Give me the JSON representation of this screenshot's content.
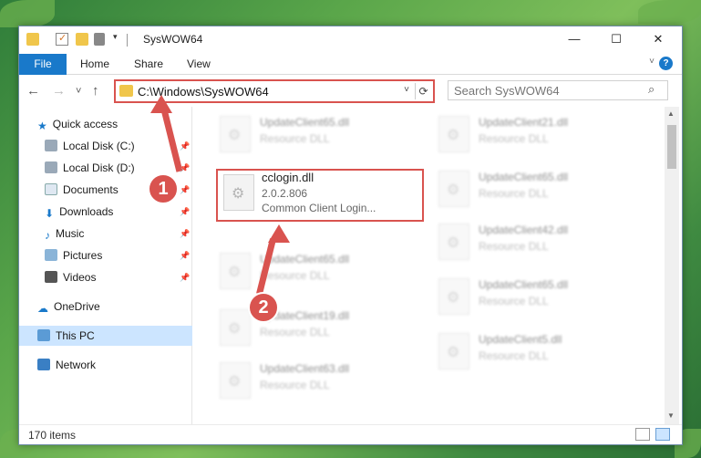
{
  "window": {
    "title": "SysWOW64",
    "minimize": "—",
    "maximize": "☐",
    "close": "✕"
  },
  "ribbon": {
    "tabs": [
      "File",
      "Home",
      "Share",
      "View"
    ],
    "help": "?"
  },
  "nav": {
    "back": "←",
    "forward": "→",
    "recent": "˅",
    "up": "↑",
    "address": "C:\\Windows\\SysWOW64",
    "search_placeholder": "Search SysWOW64"
  },
  "sidebar": {
    "items": [
      {
        "label": "Quick access",
        "pinned": false
      },
      {
        "label": "Local Disk (C:)",
        "pinned": true
      },
      {
        "label": "Local Disk (D:)",
        "pinned": true
      },
      {
        "label": "Documents",
        "pinned": true
      },
      {
        "label": "Downloads",
        "pinned": true
      },
      {
        "label": "Music",
        "pinned": true
      },
      {
        "label": "Pictures",
        "pinned": true
      },
      {
        "label": "Videos",
        "pinned": true
      },
      {
        "label": "OneDrive",
        "pinned": false
      },
      {
        "label": "This PC",
        "pinned": false
      },
      {
        "label": "Network",
        "pinned": false
      }
    ],
    "pin_glyph": "📌"
  },
  "files": {
    "left": [
      {
        "name": "UpdateClient65.dll",
        "type": "Resource DLL"
      },
      {
        "name": "UpdateClient65.dll",
        "type": "Resource DLL"
      },
      {
        "name": "UpdateClient19.dll",
        "type": "Resource DLL"
      },
      {
        "name": "UpdateClient63.dll",
        "type": "Resource DLL"
      }
    ],
    "right": [
      {
        "name": "UpdateClient21.dll",
        "type": "Resource DLL"
      },
      {
        "name": "UpdateClient65.dll",
        "type": "Resource DLL"
      },
      {
        "name": "UpdateClient42.dll",
        "type": "Resource DLL"
      },
      {
        "name": "UpdateClient65.dll",
        "type": "Resource DLL"
      },
      {
        "name": "UpdateClient5.dll",
        "type": "Resource DLL"
      }
    ],
    "highlighted": {
      "name": "cclogin.dll",
      "version": "2.0.2.806",
      "description": "Common Client Login..."
    }
  },
  "status": {
    "count": "170 items"
  },
  "annotations": {
    "step1": "1",
    "step2": "2",
    "color": "#d9534f"
  }
}
